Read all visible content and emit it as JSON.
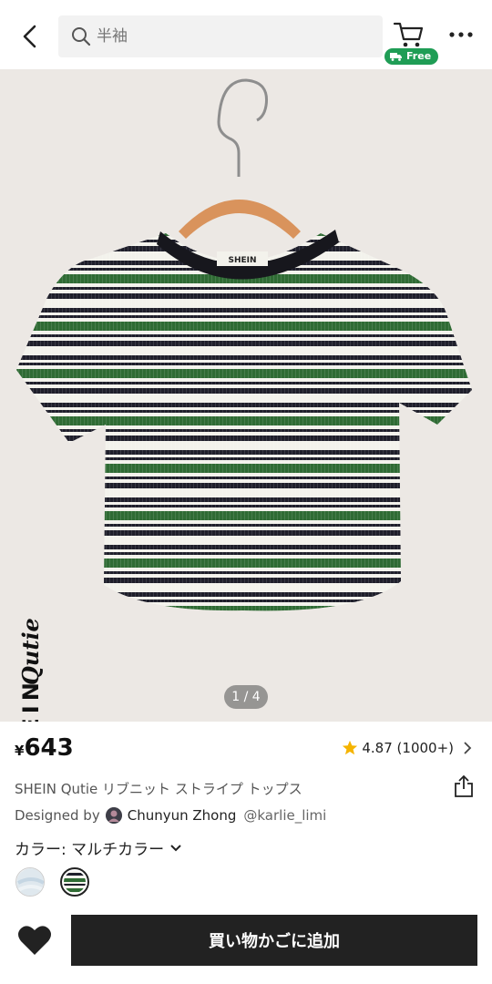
{
  "header": {
    "search_placeholder": "半袖",
    "free_badge": "Free",
    "more_icon": "more-horizontal-icon"
  },
  "gallery": {
    "brand_name": "SHEIN",
    "brand_sub": "Qutie",
    "neck_label": "SHEIN",
    "page_indicator": "1 / 4",
    "stripe_colors": [
      "#2f6b34",
      "#f5f4ef",
      "#1f1f2b"
    ]
  },
  "product": {
    "currency": "¥",
    "price": "643",
    "rating": "4.87",
    "rating_count": "(1000+)",
    "title": "SHEIN Qutie リブニット ストライプ トップス",
    "designed_by_label": "Designed by",
    "designer_name": "Chunyun Zhong",
    "designer_handle": "@karlie_limi",
    "color_label": "カラー: マルチカラー"
  },
  "actions": {
    "add_to_cart": "買い物かごに追加"
  },
  "colors": {
    "accent": "#222222",
    "free_badge": "#1f9d55",
    "star": "#f5b400"
  }
}
